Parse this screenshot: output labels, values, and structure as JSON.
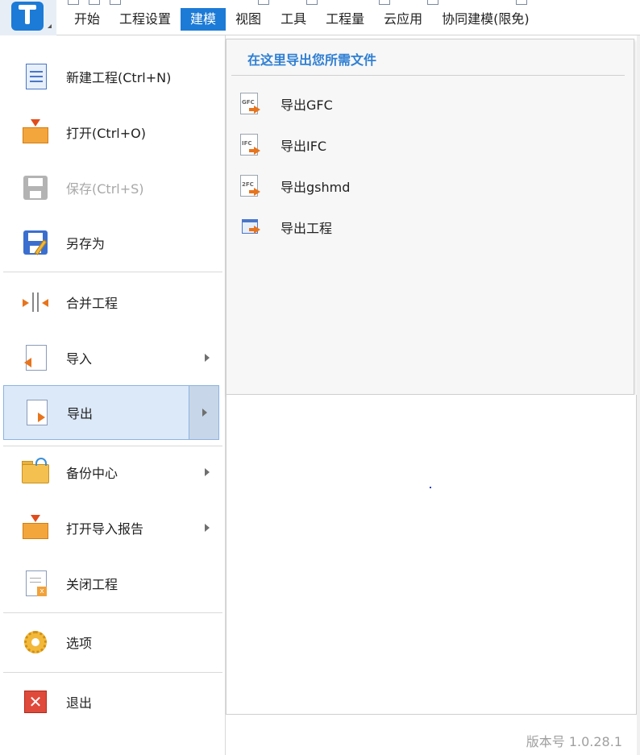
{
  "ribbon": {
    "tabs": [
      {
        "label": "开始"
      },
      {
        "label": "工程设置"
      },
      {
        "label": "建模",
        "active": true
      },
      {
        "label": "视图"
      },
      {
        "label": "工具"
      },
      {
        "label": "工程量"
      },
      {
        "label": "云应用"
      },
      {
        "label": "协同建模(限免)"
      }
    ]
  },
  "file_menu": {
    "items": [
      {
        "label": "新建工程(Ctrl+N)",
        "icon": "new-document-icon"
      },
      {
        "label": "打开(Ctrl+O)",
        "icon": "open-icon"
      },
      {
        "label": "保存(Ctrl+S)",
        "icon": "save-icon",
        "disabled": true
      },
      {
        "label": "另存为",
        "icon": "save-as-icon"
      },
      {
        "label": "合并工程",
        "icon": "merge-icon"
      },
      {
        "label": "导入",
        "icon": "import-icon",
        "submenu": true
      },
      {
        "label": "导出",
        "icon": "export-icon",
        "submenu": true,
        "selected": true
      },
      {
        "label": "备份中心",
        "icon": "backup-folder-icon",
        "submenu": true
      },
      {
        "label": "打开导入报告",
        "icon": "open-report-icon",
        "submenu": true
      },
      {
        "label": "关闭工程",
        "icon": "close-project-icon"
      },
      {
        "label": "选项",
        "icon": "gear-icon"
      },
      {
        "label": "退出",
        "icon": "exit-icon"
      }
    ]
  },
  "export_submenu": {
    "title": "在这里导出您所需文件",
    "items": [
      {
        "label": "导出GFC",
        "icon": "export-gfc-icon",
        "icon_text": "GFC"
      },
      {
        "label": "导出IFC",
        "icon": "export-ifc-icon",
        "icon_text": "IFC"
      },
      {
        "label": "导出gshmd",
        "icon": "export-gshmd-icon",
        "icon_text": "2FC"
      },
      {
        "label": "导出工程",
        "icon": "export-project-icon"
      }
    ]
  },
  "footer": {
    "version": "版本号 1.0.28.1"
  },
  "colors": {
    "accent": "#1c7bd6",
    "submenu_title": "#2f7fd3",
    "selected_bg": "#dce9f8",
    "disabled_text": "#a8a8a8"
  }
}
